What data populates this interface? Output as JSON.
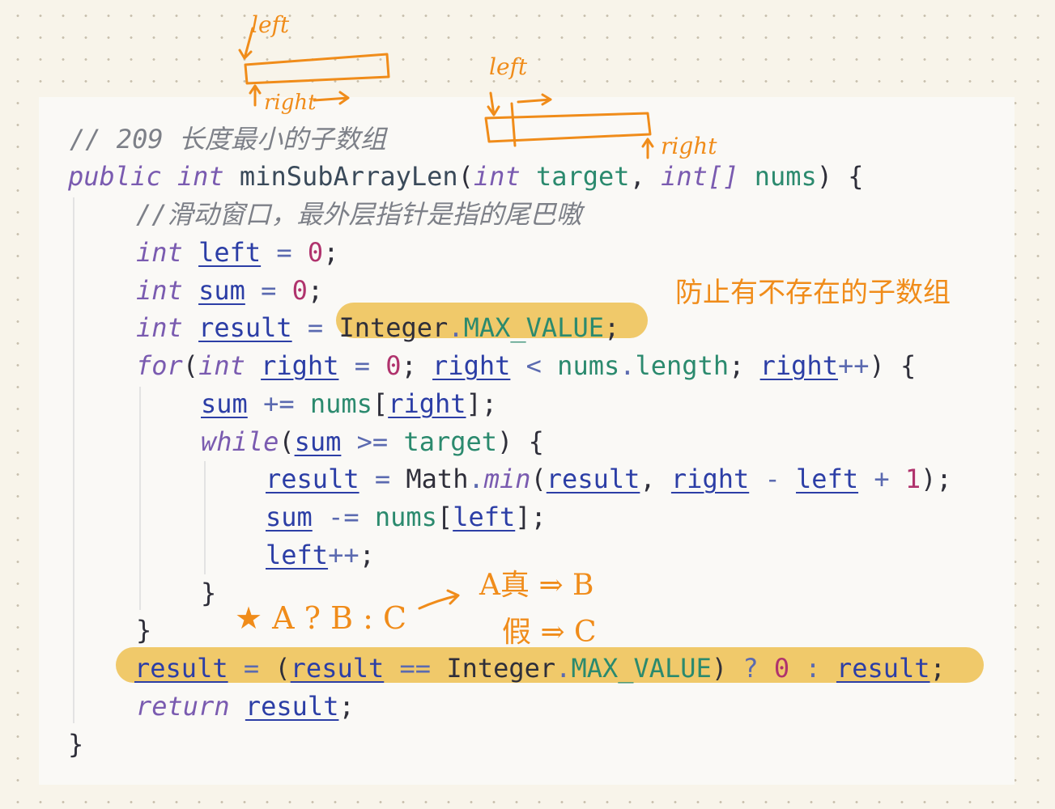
{
  "code": {
    "comment_title": "// 209 长度最小的子数组",
    "signature": {
      "kw_public": "public",
      "kw_int": "int",
      "method": "minSubArrayLen",
      "open_paren": "(",
      "param_type1": "int",
      "param1": "target",
      "comma": ",",
      "param_type2": "int[]",
      "param2": "nums",
      "close": ") {"
    },
    "comment_window": "//滑动窗口，最外层指针是指的尾巴嗷",
    "decl_left": {
      "type": "int",
      "name": "left",
      "eq": " = ",
      "value": "0",
      "end": ";"
    },
    "decl_sum": {
      "type": "int",
      "name": "sum",
      "eq": " = ",
      "value": "0",
      "end": ";"
    },
    "decl_result": {
      "type": "int",
      "name": "result",
      "eq": " = ",
      "cls": "Integer",
      "dot": ".",
      "field": "MAX_VALUE",
      "end": ";"
    },
    "for_line": {
      "kw_for": "for",
      "open": "(",
      "type": "int",
      "var": "right",
      "init": " = ",
      "zero": "0",
      "semi1": "; ",
      "var2": "right",
      "lt": " < ",
      "nums": "nums",
      "dot": ".",
      "length": "length",
      "semi2": "; ",
      "var3": "right",
      "inc": "++",
      "close": ") {"
    },
    "sum_add": {
      "var": "sum",
      "op": " += ",
      "nums": "nums",
      "lb": "[",
      "idx": "right",
      "rb": "];"
    },
    "while_line": {
      "kw": "while",
      "open": "(",
      "var": "sum",
      "op": " >= ",
      "target": "target",
      "close": ") {"
    },
    "result_min": {
      "var": "result",
      "eq": " = ",
      "cls": "Math",
      "dot": ".",
      "fn": "min",
      "open": "(",
      "arg1": "result",
      "comma": ", ",
      "arg2": "right",
      "minus": " - ",
      "arg3": "left",
      "plus": " + ",
      "one": "1",
      "close": ");"
    },
    "sum_sub": {
      "var": "sum",
      "op": " -= ",
      "nums": "nums",
      "lb": "[",
      "idx": "left",
      "rb": "];"
    },
    "left_inc": {
      "var": "left",
      "inc": "++",
      "end": ";"
    },
    "close_while": "}",
    "close_for": "}",
    "ternary": {
      "var": "result",
      "eq": " = ",
      "open": "(",
      "cmp_var": "result",
      "eqeq": " == ",
      "cls": "Integer",
      "dot": ".",
      "field": "MAX_VALUE",
      "close": ")",
      "q": " ? ",
      "zero": "0",
      "colon": " : ",
      "else_var": "result",
      "end": ";"
    },
    "return_line": {
      "kw": "return",
      "var": "result",
      "end": ";"
    },
    "close_method": "}"
  },
  "annotations": {
    "left_label_1": "left",
    "right_label_1": "right",
    "left_label_2": "left",
    "right_label_2": "right",
    "note_max_value": "防止有不存在的子数组",
    "ternary_syntax": "★ A ? B : C",
    "ternary_true": "A真 ⇒ B",
    "ternary_false": "假 ⇒ C"
  },
  "colors": {
    "annotation": "#f08c1a",
    "highlight": "#f0c96a",
    "keyword": "#7a5bb0",
    "variable": "#2c3ea6",
    "number": "#b0336d",
    "field": "#2b8a6e",
    "comment": "#7d8088"
  }
}
